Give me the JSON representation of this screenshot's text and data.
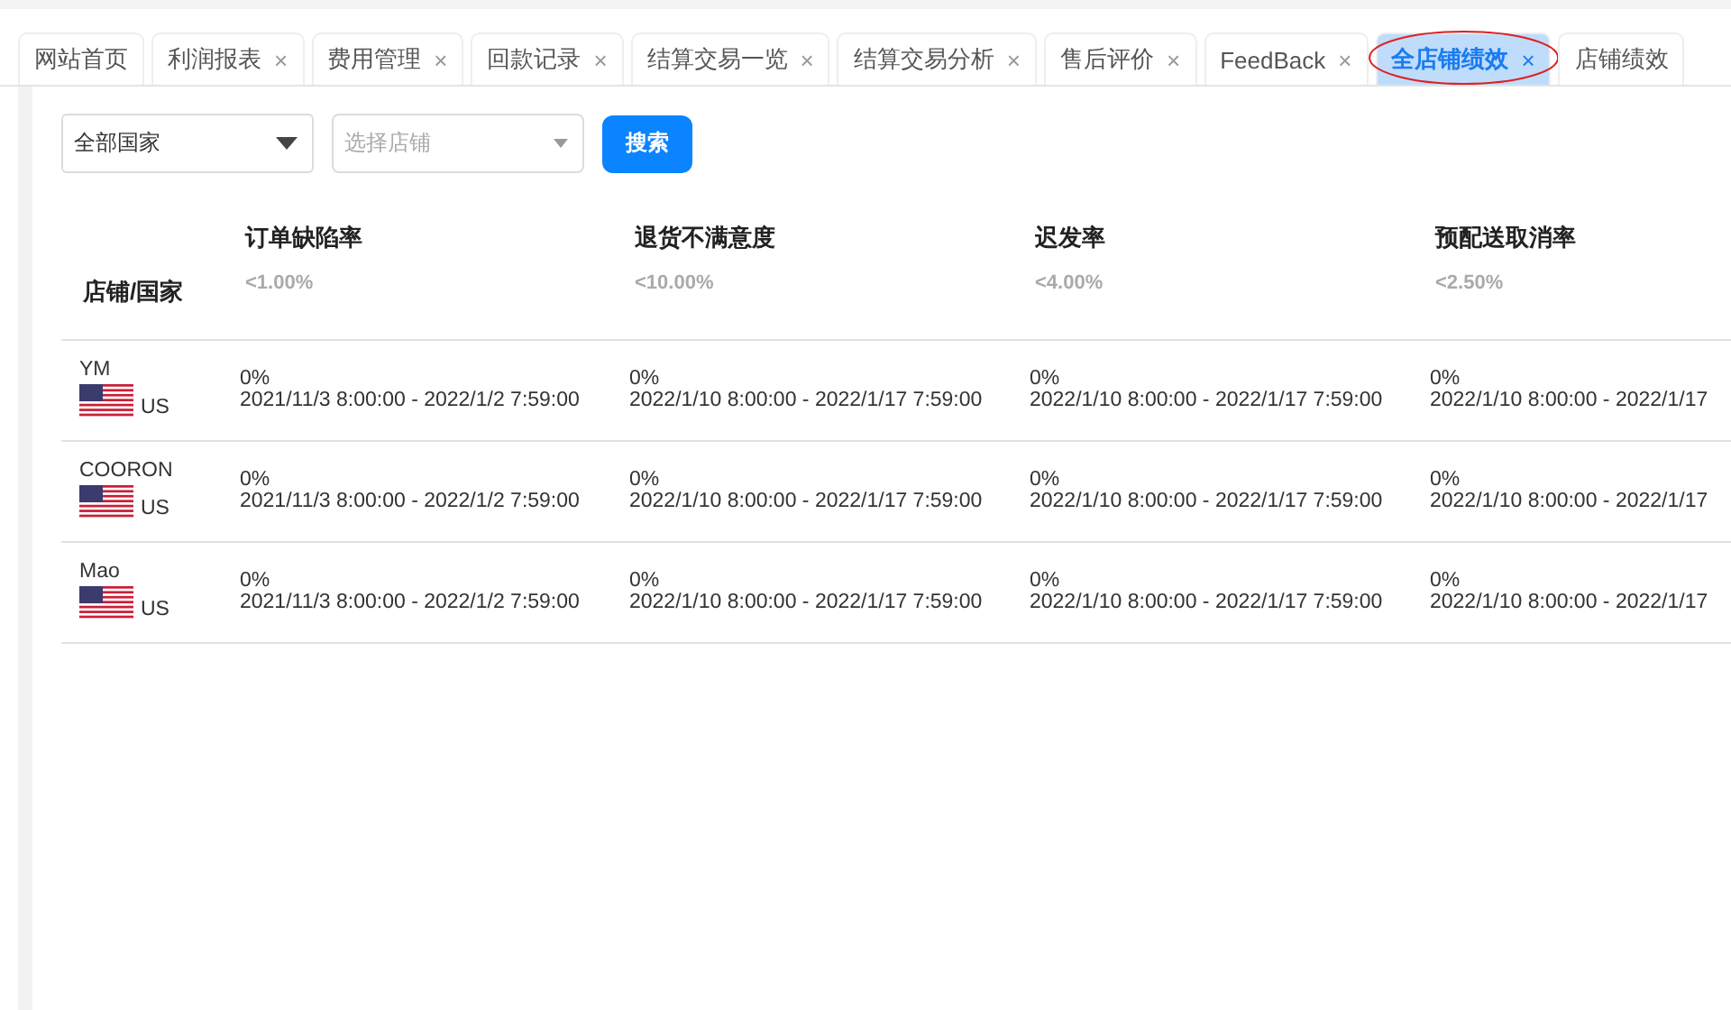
{
  "tabs": [
    {
      "label": "网站首页",
      "selected": false,
      "circled": false
    },
    {
      "label": "利润报表",
      "close": "×",
      "selected": false,
      "circled": false
    },
    {
      "label": "费用管理",
      "close": "×",
      "selected": false,
      "circled": false
    },
    {
      "label": "回款记录",
      "close": "×",
      "selected": false,
      "circled": false
    },
    {
      "label": "结算交易一览",
      "close": "×",
      "selected": false,
      "circled": false
    },
    {
      "label": "结算交易分析",
      "close": "×",
      "selected": false,
      "circled": false
    },
    {
      "label": "售后评价",
      "close": "×",
      "selected": false,
      "circled": false
    },
    {
      "label": "FeedBack",
      "close": "×",
      "selected": false,
      "circled": false
    },
    {
      "label": "全店铺绩效",
      "close": "×",
      "selected": true,
      "circled": true
    },
    {
      "label": "店铺绩效",
      "selected": false,
      "circled": false
    }
  ],
  "filters": {
    "country": {
      "value": "全部国家"
    },
    "store": {
      "placeholder": "选择店铺"
    },
    "search_button": "搜索"
  },
  "table": {
    "store_column": "店铺/国家",
    "columns": [
      {
        "title": "订单缺陷率",
        "threshold": "<1.00%"
      },
      {
        "title": "退货不满意度",
        "threshold": "<10.00%"
      },
      {
        "title": "迟发率",
        "threshold": "<4.00%"
      },
      {
        "title": "预配送取消率",
        "threshold": "<2.50%"
      }
    ],
    "rows": [
      {
        "store": "YM",
        "country": "US",
        "cells": [
          {
            "value": "0%",
            "period": "2021/11/3 8:00:00 - 2022/1/2 7:59:00"
          },
          {
            "value": "0%",
            "period": "2022/1/10 8:00:00 - 2022/1/17 7:59:00"
          },
          {
            "value": "0%",
            "period": "2022/1/10 8:00:00 - 2022/1/17 7:59:00"
          },
          {
            "value": "0%",
            "period": "2022/1/10 8:00:00 - 2022/1/17"
          }
        ]
      },
      {
        "store": "COORON",
        "country": "US",
        "cells": [
          {
            "value": "0%",
            "period": "2021/11/3 8:00:00 - 2022/1/2 7:59:00"
          },
          {
            "value": "0%",
            "period": "2022/1/10 8:00:00 - 2022/1/17 7:59:00"
          },
          {
            "value": "0%",
            "period": "2022/1/10 8:00:00 - 2022/1/17 7:59:00"
          },
          {
            "value": "0%",
            "period": "2022/1/10 8:00:00 - 2022/1/17"
          }
        ]
      },
      {
        "store": "Mao",
        "country": "US",
        "cells": [
          {
            "value": "0%",
            "period": "2021/11/3 8:00:00 - 2022/1/2 7:59:00"
          },
          {
            "value": "0%",
            "period": "2022/1/10 8:00:00 - 2022/1/17 7:59:00"
          },
          {
            "value": "0%",
            "period": "2022/1/10 8:00:00 - 2022/1/17 7:59:00"
          },
          {
            "value": "0%",
            "period": "2022/1/10 8:00:00 - 2022/1/17"
          }
        ]
      }
    ]
  }
}
